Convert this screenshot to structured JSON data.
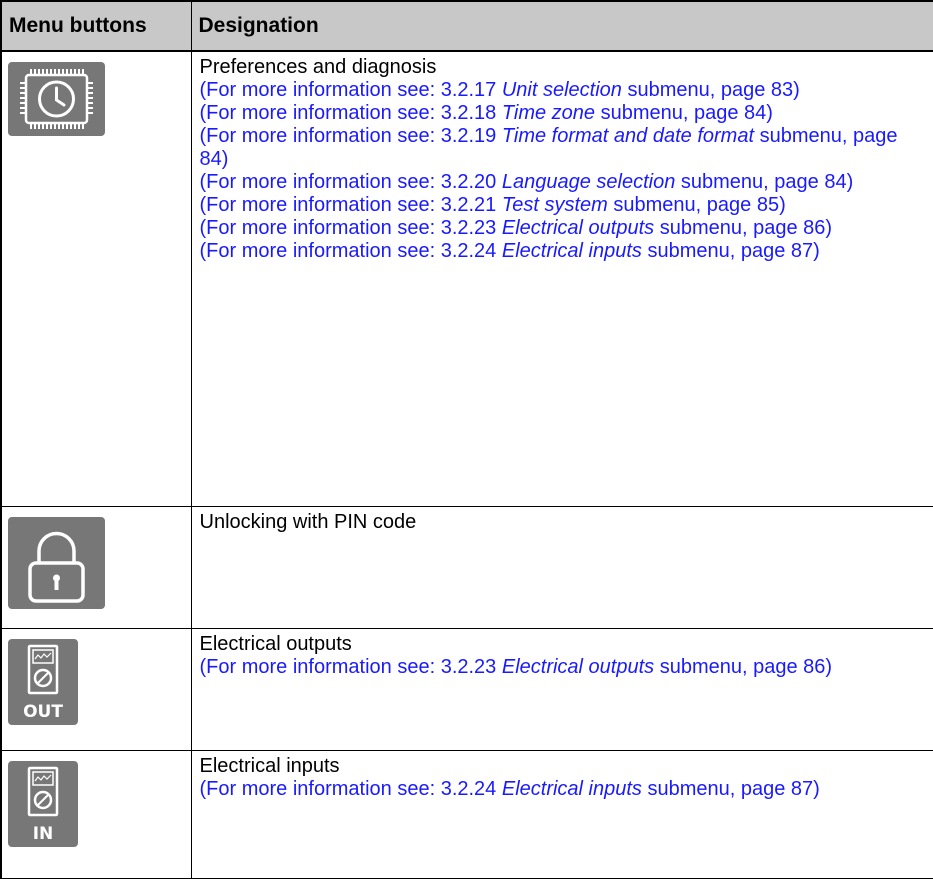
{
  "table": {
    "header": {
      "col1": "Menu buttons",
      "col2": "Designation"
    },
    "rows": [
      {
        "icon": "preferences-clock-chip-icon",
        "title": "Preferences and diagnosis",
        "refs": [
          {
            "prefix": "(For more information see: 3.2.17 ",
            "topic": "Unit selection",
            "suffix": " submenu, page 83)"
          },
          {
            "prefix": "(For more information see: 3.2.18 ",
            "topic": "Time zone",
            "suffix": " submenu, page 84)"
          },
          {
            "prefix": "(For more information see: 3.2.19 ",
            "topic": "Time format and date format",
            "suffix": " submenu, page 84)"
          },
          {
            "prefix": "(For more information see: 3.2.20 ",
            "topic": "Language selection",
            "suffix": " submenu, page 84)"
          },
          {
            "prefix": "(For more information see: 3.2.21 ",
            "topic": "Test system",
            "suffix": " submenu, page 85)"
          },
          {
            "prefix": "(For more information see: 3.2.23 ",
            "topic": "Electrical outputs",
            "suffix": " submenu, page 86)"
          },
          {
            "prefix": "(For more information see: 3.2.24 ",
            "topic": "Electrical inputs",
            "suffix": " submenu, page 87)"
          }
        ]
      },
      {
        "icon": "padlock-icon",
        "title": "Unlocking with PIN code",
        "refs": []
      },
      {
        "icon": "electrical-outputs-meter-icon",
        "icon_label": "OUT",
        "title": "Electrical outputs",
        "refs": [
          {
            "prefix": "(For more information see: 3.2.23 ",
            "topic": "Electrical outputs",
            "suffix": " submenu, page 86)"
          }
        ]
      },
      {
        "icon": "electrical-inputs-meter-icon",
        "icon_label": "IN",
        "title": "Electrical inputs",
        "refs": [
          {
            "prefix": "(For more information see: 3.2.24 ",
            "topic": "Electrical inputs",
            "suffix": " submenu, page 87)"
          }
        ]
      }
    ]
  },
  "colors": {
    "header_bg": "#c8c8c8",
    "link": "#1a1aff",
    "icon_bg": "#777777"
  }
}
